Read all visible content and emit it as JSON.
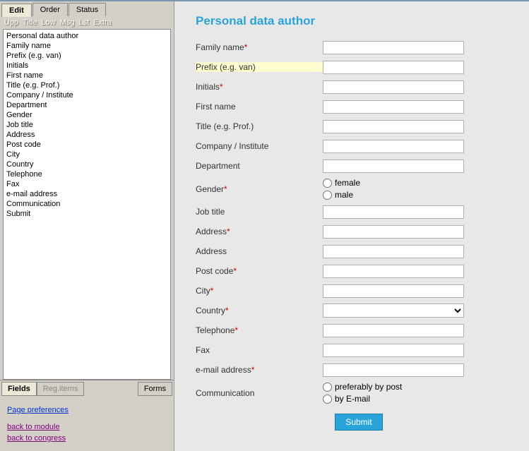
{
  "sidebar": {
    "tabs": [
      {
        "label": "Edit",
        "active": true
      },
      {
        "label": "Order",
        "active": false
      },
      {
        "label": "Status",
        "active": false
      }
    ],
    "toolbar": [
      "Upp",
      "Title",
      "Low",
      "Msg",
      "Lst",
      "Extra"
    ],
    "list_items": [
      "Personal data author",
      "Family name",
      "Prefix (e.g. van)",
      "Initials",
      "First name",
      "Title (e.g. Prof.)",
      "Company / Institute",
      "Department",
      "Gender",
      "Job title",
      "Address",
      "Post code",
      "City",
      "Country",
      "Telephone",
      "Fax",
      "e-mail address",
      "Communication",
      "Submit"
    ],
    "bottom_tabs": {
      "fields": "Fields",
      "regitems": "Reg.items",
      "forms": "Forms"
    },
    "links": {
      "page_prefs": "Page preferences",
      "back_module": "back to module",
      "back_congress": "back to congress"
    }
  },
  "form": {
    "title": "Personal data author",
    "fields": {
      "family_name": {
        "label": "Family name",
        "required": true,
        "type": "text"
      },
      "prefix": {
        "label": "Prefix (e.g. van)",
        "required": false,
        "type": "text",
        "highlight": true
      },
      "initials": {
        "label": "Initials",
        "required": true,
        "type": "text"
      },
      "first_name": {
        "label": "First name",
        "required": false,
        "type": "text"
      },
      "title": {
        "label": "Title (e.g. Prof.)",
        "required": false,
        "type": "text"
      },
      "company": {
        "label": "Company / Institute",
        "required": false,
        "type": "text"
      },
      "department": {
        "label": "Department",
        "required": false,
        "type": "text"
      },
      "gender": {
        "label": "Gender",
        "required": true,
        "type": "radio",
        "options": [
          "female",
          "male"
        ]
      },
      "job_title": {
        "label": "Job title",
        "required": false,
        "type": "text"
      },
      "address1": {
        "label": "Address",
        "required": true,
        "type": "text"
      },
      "address2": {
        "label": "Address",
        "required": false,
        "type": "text"
      },
      "post_code": {
        "label": "Post code",
        "required": true,
        "type": "text"
      },
      "city": {
        "label": "City",
        "required": true,
        "type": "text"
      },
      "country": {
        "label": "Country",
        "required": true,
        "type": "select"
      },
      "telephone": {
        "label": "Telephone",
        "required": true,
        "type": "text"
      },
      "fax": {
        "label": "Fax",
        "required": false,
        "type": "text"
      },
      "email": {
        "label": "e-mail address",
        "required": true,
        "type": "text"
      },
      "communication": {
        "label": "Communication",
        "required": false,
        "type": "radio",
        "options": [
          "preferably by post",
          "by E-mail"
        ]
      }
    },
    "submit_label": "Submit"
  }
}
